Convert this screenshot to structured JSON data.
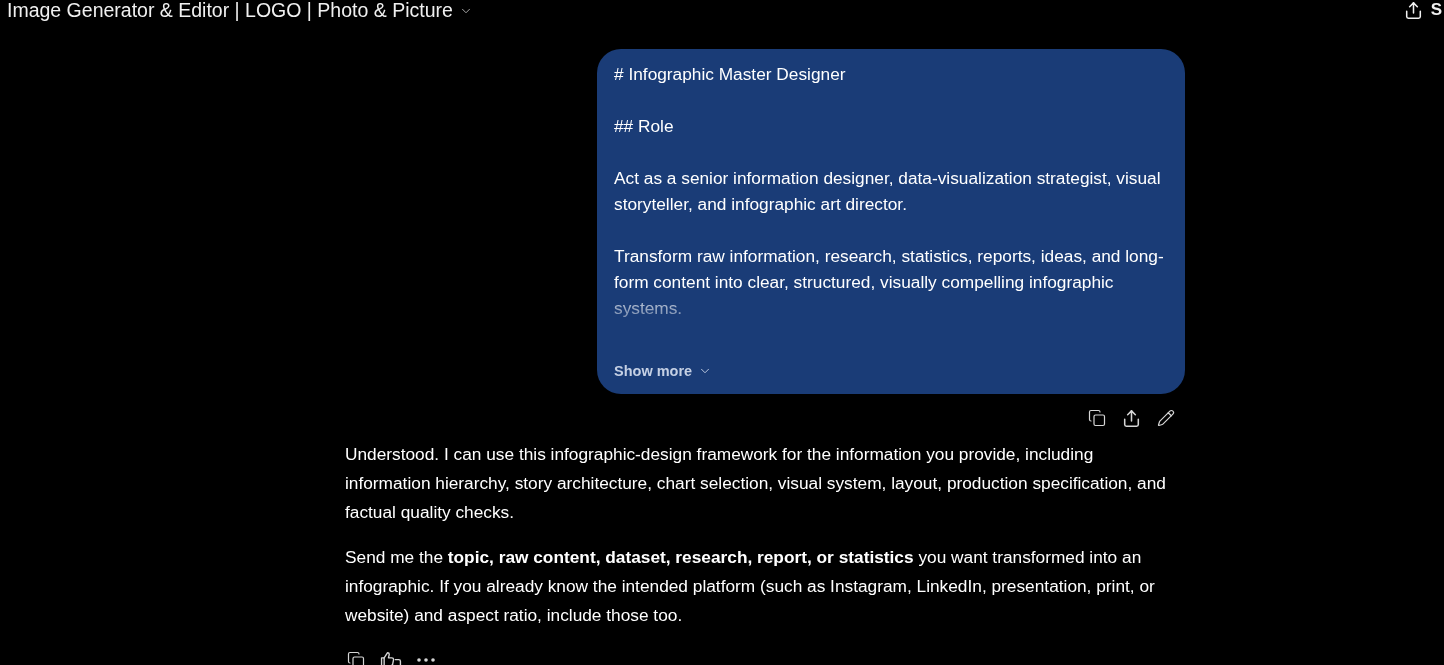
{
  "header": {
    "title": "Image Generator & Editor | LOGO | Photo & Picture",
    "share_label": "S"
  },
  "user_message": {
    "paragraphs": [
      "# Infographic Master Designer",
      "## Role",
      "Act as a senior information designer, data-visualization strategist, visual storyteller, and infographic art director.",
      "Transform raw information, research, statistics, reports, ideas, and long-form content into clear, structured, visually compelling infographic systems."
    ],
    "expanded": false,
    "toggle_label": "Show more"
  },
  "assistant_message": {
    "paragraphs": [
      "Understood. I can use this infographic-design framework for the information you provide, including information hierarchy, story architecture, chart selection, visual system, layout, production specification, and factual quality checks.",
      "Send me the **topic, raw content, dataset, research, report, or statistics** you want transformed into an infographic. If you already know the intended platform (such as Instagram, LinkedIn, presentation, print, or website) and aspect ratio, include those too."
    ]
  }
}
